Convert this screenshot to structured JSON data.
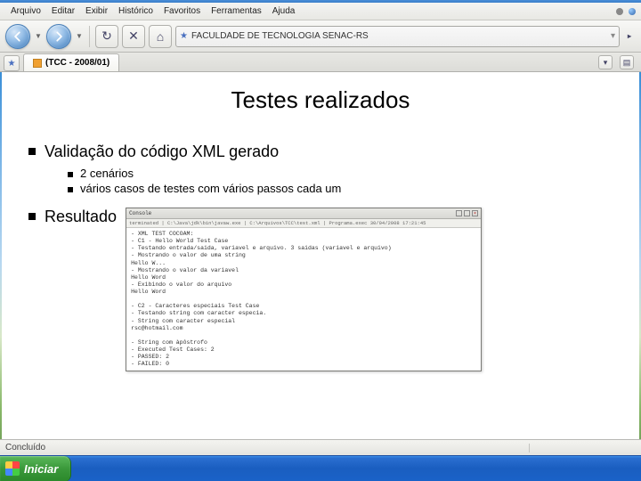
{
  "menubar": {
    "items": [
      "Arquivo",
      "Editar",
      "Exibir",
      "Histórico",
      "Favoritos",
      "Ferramentas",
      "Ajuda"
    ]
  },
  "toolbar": {
    "back_label": "←",
    "fwd_label": "→",
    "reload_glyph": "↻",
    "stop_glyph": "✕",
    "home_glyph": "⌂"
  },
  "address": {
    "text": "FACULDADE DE TECNOLOGIA SENAC-RS"
  },
  "tabs": {
    "active": "(TCC - 2008/01)"
  },
  "slide": {
    "title": "Testes realizados",
    "bullet1": "Validação do código XML gerado",
    "sub1": "2 cenários",
    "sub2": "vários casos de testes com vários passos cada um",
    "bullet2": "Resultado"
  },
  "console": {
    "title": "Console",
    "toolbar": "terminated | C:\\Java\\jdk\\bin\\javaw.exe | C:\\Arquivos\\TCC\\test.xml | Programa.exec 30/04/2008 17:21:45",
    "lines": [
      "- XML TEST COCOAM:",
      "- C1 - Hello World Test Case",
      "- Testando entrada/saida, variavel e arquivo. 3 saidas (variavel e arquivo)",
      "- Mostrando o valor de uma string",
      "Hello W...",
      "- Mostrando o valor da variavel",
      "Hello Word",
      "- Exibindo o valor do arquivo",
      "Hello Word",
      "",
      "- C2 - Caracteres especiais Test Case",
      "- Testando string com caracter especia.",
      "- String com caracter especial",
      "rsc@hotmail.com",
      "",
      "- String com àpôstrofo",
      "- Executed Test Cases: 2",
      "- PASSED: 2",
      "- FAILED: 0"
    ]
  },
  "statusbar": {
    "text": "Concluído"
  },
  "taskbar": {
    "start": "Iniciar"
  }
}
